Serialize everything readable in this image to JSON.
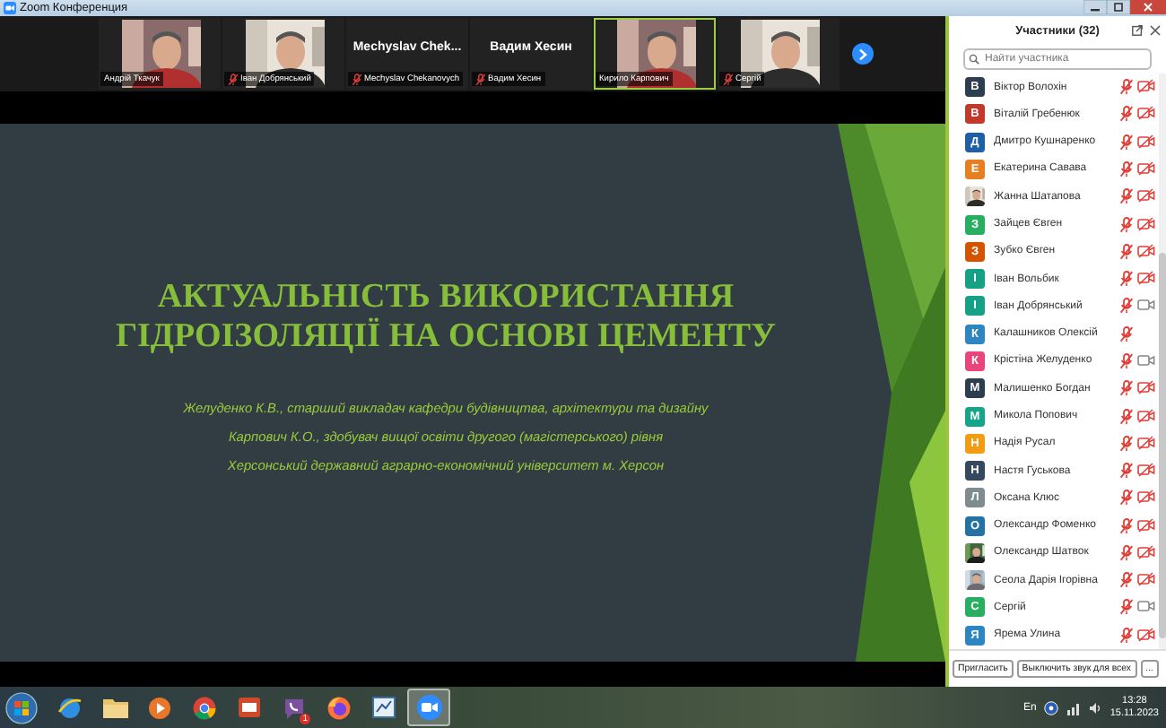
{
  "window": {
    "title": "Zoom Конференция"
  },
  "video_strip": {
    "tiles": [
      {
        "kind": "video",
        "label": "Андрій Ткачук",
        "muted": false,
        "speaking": false
      },
      {
        "kind": "video",
        "label": "Іван Добрянський",
        "muted": true,
        "speaking": false
      },
      {
        "kind": "name",
        "display_name": "Mechyslav  Chek...",
        "label": "Mechyslav Chekanovych",
        "muted": true,
        "speaking": false
      },
      {
        "kind": "name",
        "display_name": "Вадим Хесин",
        "label": "Вадим Хесин",
        "muted": true,
        "speaking": false
      },
      {
        "kind": "video",
        "label": "Кирило Карпович",
        "muted": false,
        "speaking": true
      },
      {
        "kind": "video",
        "label": "Сергій",
        "muted": true,
        "speaking": false
      }
    ]
  },
  "slide": {
    "title": "АКТУАЛЬНІСТЬ ВИКОРИСТАННЯ ГІДРОІЗОЛЯЦІЇ НА ОСНОВІ ЦЕМЕНТУ",
    "lines": [
      "Желуденко К.В., старший викладач кафедри будівництва, архітектури та дизайну",
      "Карпович К.О., здобувач вищої освіти другого (магістерського) рівня",
      "Херсонський державний аграрно-економічний університет м. Херсон"
    ]
  },
  "participants": {
    "title": "Участники (32)",
    "search": {
      "placeholder": "Найти участника"
    },
    "items": [
      {
        "kind": "letter",
        "initial": "В",
        "color": "#2c3e50",
        "name": "Віктор Волохін",
        "muted": true,
        "camera": true,
        "video_off": true
      },
      {
        "kind": "letter",
        "initial": "В",
        "color": "#c0392b",
        "name": "Віталій Гребенюк",
        "muted": true,
        "camera": true,
        "video_off": true
      },
      {
        "kind": "letter",
        "initial": "Д",
        "color": "#1f5fa6",
        "name": "Дмитро Кушнаренко",
        "muted": true,
        "camera": true,
        "video_off": true
      },
      {
        "kind": "letter",
        "initial": "Е",
        "color": "#e67e22",
        "name": "Екатерина Савава",
        "muted": true,
        "camera": true,
        "video_off": true
      },
      {
        "name": "Жанна Шатапова",
        "muted": true,
        "camera": true,
        "video_off": true
      },
      {
        "kind": "letter",
        "initial": "З",
        "color": "#27ae60",
        "name": "Зайцев Євген",
        "muted": true,
        "camera": true,
        "video_off": true
      },
      {
        "kind": "letter",
        "initial": "З",
        "color": "#d35400",
        "name": "Зубко Євген",
        "muted": true,
        "camera": true,
        "video_off": true
      },
      {
        "kind": "letter",
        "initial": "І",
        "color": "#16a085",
        "name": "Іван Вольбик",
        "muted": true,
        "camera": true,
        "video_off": true
      },
      {
        "kind": "letter",
        "initial": "І",
        "color": "#16a085",
        "name": "Іван Добрянський",
        "muted": true,
        "camera": true,
        "video_off": false
      },
      {
        "kind": "letter",
        "initial": "К",
        "color": "#2e86c1",
        "name": "Калашников Олексій",
        "muted": true,
        "camera": false
      },
      {
        "kind": "letter",
        "initial": "К",
        "color": "#e8457a",
        "name": "Крістіна Желуденко",
        "muted": true,
        "camera": true,
        "video_off": false
      },
      {
        "kind": "letter",
        "initial": "М",
        "color": "#2c3e50",
        "name": "Малишенко Богдан",
        "muted": true,
        "camera": true,
        "video_off": true
      },
      {
        "kind": "letter",
        "initial": "М",
        "color": "#17a589",
        "name": "Микола Попович",
        "muted": true,
        "camera": true,
        "video_off": true
      },
      {
        "kind": "letter",
        "initial": "Н",
        "color": "#f39c12",
        "name": "Надія Русал",
        "muted": true,
        "camera": true,
        "video_off": true
      },
      {
        "kind": "letter",
        "initial": "Н",
        "color": "#34495e",
        "name": "Настя Гуськова",
        "muted": true,
        "camera": true,
        "video_off": true
      },
      {
        "kind": "letter",
        "initial": "Л",
        "color": "#7f8c8d",
        "name": "Оксана Клюс",
        "muted": true,
        "camera": true,
        "video_off": true
      },
      {
        "kind": "letter",
        "initial": "О",
        "color": "#2471a3",
        "name": "Олександр Фоменко",
        "muted": true,
        "camera": true,
        "video_off": true
      },
      {
        "name": "Олександр Шатвок",
        "muted": true,
        "camera": true,
        "video_off": true
      },
      {
        "name": "Сеола Дарія Ігорівна",
        "muted": true,
        "camera": true,
        "video_off": true
      },
      {
        "kind": "letter",
        "initial": "С",
        "color": "#27ae60",
        "name": "Сергій",
        "muted": true,
        "camera": true,
        "video_off": false
      },
      {
        "kind": "letter",
        "initial": "Я",
        "color": "#2e86c1",
        "name": "Ярема Улина",
        "muted": true,
        "camera": true,
        "video_off": true
      }
    ],
    "buttons": [
      "Пригласить",
      "Выключить звук для всех",
      "..."
    ]
  },
  "taskbar": {
    "apps": [
      {
        "kind": "explorer-ie",
        "active": false
      },
      {
        "kind": "folder",
        "active": false
      },
      {
        "kind": "player",
        "active": false
      },
      {
        "kind": "chrome",
        "active": false
      },
      {
        "kind": "slides",
        "active": false
      },
      {
        "kind": "viber",
        "active": false,
        "badge": "1"
      },
      {
        "kind": "firefox",
        "active": false
      },
      {
        "kind": "board",
        "active": false
      },
      {
        "kind": "zoom",
        "active": true
      }
    ],
    "language": "En",
    "time": "13:28",
    "date": "15.11.2023"
  }
}
